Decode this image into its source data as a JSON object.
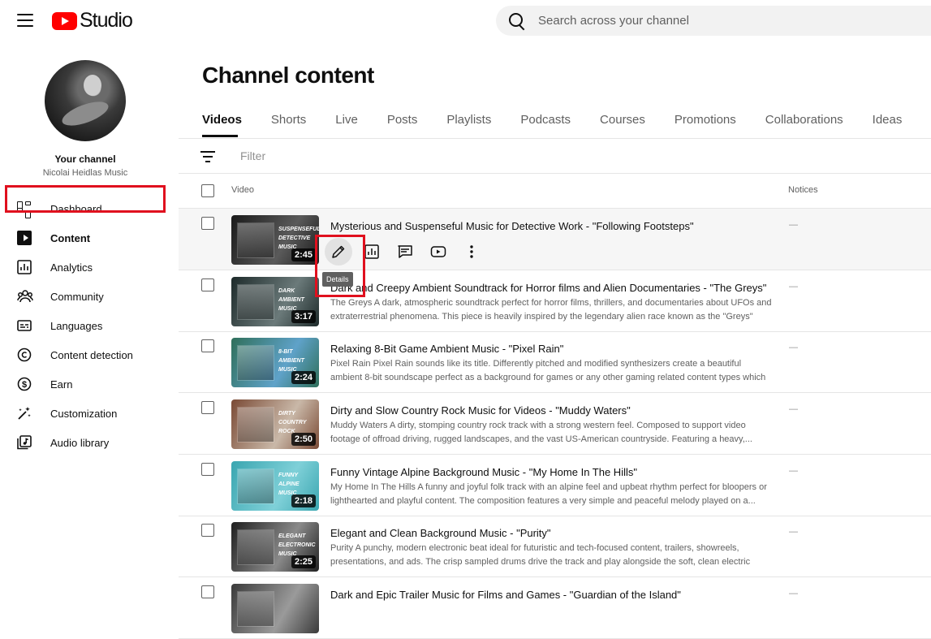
{
  "app": {
    "brand": "Studio",
    "brand_color": "#ff0000"
  },
  "search": {
    "placeholder": "Search across your channel"
  },
  "sidebar": {
    "channel_label": "Your channel",
    "channel_name": "Nicolai Heidlas Music",
    "items": [
      {
        "label": "Dashboard",
        "icon": "dashboard-icon"
      },
      {
        "label": "Content",
        "icon": "content-icon",
        "active": true
      },
      {
        "label": "Analytics",
        "icon": "analytics-icon"
      },
      {
        "label": "Community",
        "icon": "community-icon"
      },
      {
        "label": "Languages",
        "icon": "subtitles-icon"
      },
      {
        "label": "Content detection",
        "icon": "copyright-icon"
      },
      {
        "label": "Earn",
        "icon": "dollar-icon"
      },
      {
        "label": "Customization",
        "icon": "magic-wand-icon"
      },
      {
        "label": "Audio library",
        "icon": "audio-library-icon"
      }
    ]
  },
  "main": {
    "title": "Channel content",
    "tabs": [
      "Videos",
      "Shorts",
      "Live",
      "Posts",
      "Playlists",
      "Podcasts",
      "Courses",
      "Promotions",
      "Collaborations",
      "Ideas"
    ],
    "active_tab": "Videos",
    "filter_placeholder": "Filter",
    "columns": {
      "video": "Video",
      "notices": "Notices"
    },
    "tooltip": "Details",
    "highlight_color": "#e0101e",
    "videos": [
      {
        "title": "Mysterious and Suspenseful Music for Detective Work - \"Following Footsteps\"",
        "description": "",
        "duration": "2:45",
        "thumb_text": "SUSPENSEFUL\nDETECTIVE\nMUSIC",
        "thumb_colors": [
          "#1a1a1a",
          "#5a5a5a"
        ],
        "notice": "—"
      },
      {
        "title": "Dark and Creepy Ambient Soundtrack for Horror films and Alien Documentaries - \"The Greys\"",
        "description": "The Greys A dark, atmospheric soundtrack perfect for horror films, thrillers, and documentaries about UFOs and extraterrestrial phenomena. This piece is heavily inspired by the legendary alien race known as the \"Greys\" and...",
        "duration": "3:17",
        "thumb_text": "DARK\nAMBIENT\nMUSIC",
        "thumb_colors": [
          "#1d2a2a",
          "#6b7a7a"
        ],
        "notice": "—"
      },
      {
        "title": "Relaxing 8-Bit Game Ambient Music - \"Pixel Rain\"",
        "description": "Pixel Rain Pixel Rain sounds like its title. Differently pitched and modified synthesizers create a beautiful ambient 8-bit soundscape perfect as a background for games or any other gaming related content types which call for a...",
        "duration": "2:24",
        "thumb_text": "8-BIT\nAMBIENT\nMUSIC",
        "thumb_colors": [
          "#2f6f5a",
          "#5fa2c9"
        ],
        "notice": "—"
      },
      {
        "title": "Dirty and Slow Country Rock Music for Videos - \"Muddy Waters\"",
        "description": "Muddy Waters A dirty, stomping country rock track with a strong western feel. Composed to support video footage of offroad driving, rugged landscapes, and the vast US-American countryside. Featuring a heavy,...",
        "duration": "2:50",
        "thumb_text": "DIRTY\nCOUNTRY\nROCK",
        "thumb_colors": [
          "#7a4a35",
          "#c9b8a8"
        ],
        "notice": "—"
      },
      {
        "title": "Funny Vintage Alpine Background Music - \"My Home In The Hills\"",
        "description": "My Home In The Hills A funny and joyful folk track with an alpine feel and upbeat rhythm perfect for bloopers or lighthearted and playful content. The composition features a very simple and peaceful melody played on a...",
        "duration": "2:18",
        "thumb_text": "FUNNY\nALPINE\nMUSIC",
        "thumb_colors": [
          "#3aa6b0",
          "#7fd0d8"
        ],
        "notice": "—"
      },
      {
        "title": "Elegant and Clean Background Music - \"Purity\"",
        "description": "Purity A punchy, modern electronic beat ideal for futuristic and tech-focused content, trailers, showreels, presentations, and ads. The crisp sampled drums drive the track and play alongside the soft, clean electric keys...",
        "duration": "2:25",
        "thumb_text": "ELEGANT\nELECTRONIC\nMUSIC",
        "thumb_colors": [
          "#202020",
          "#8a8a8a"
        ],
        "notice": "—"
      },
      {
        "title": "Dark and Epic Trailer Music for Films and Games - \"Guardian of the Island\"",
        "description": "",
        "duration": "",
        "thumb_text": "",
        "thumb_colors": [
          "#3a3a3a",
          "#9a9a9a"
        ],
        "notice": "—"
      }
    ]
  }
}
